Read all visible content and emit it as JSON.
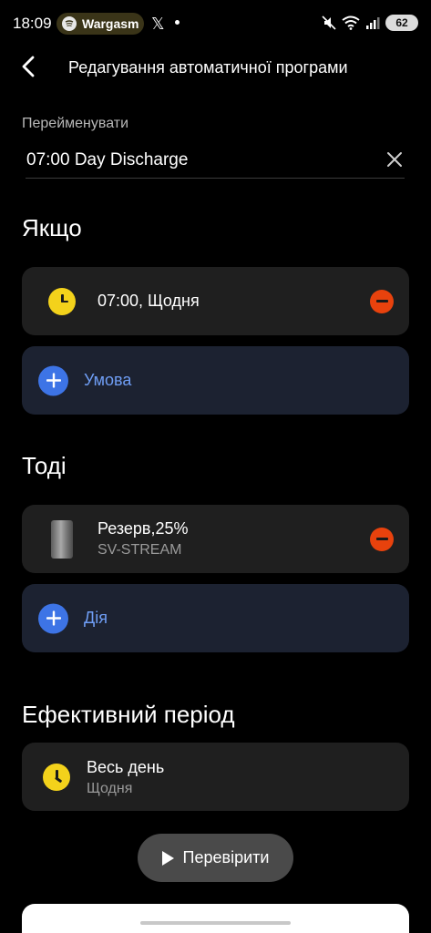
{
  "status_bar": {
    "time": "18:09",
    "notification_app": "Wargasm",
    "x_app": "𝕏",
    "battery": "62"
  },
  "header": {
    "title": "Редагування автоматичної програми"
  },
  "rename": {
    "label": "Перейменувати",
    "value": "07:00 Day Discharge"
  },
  "if_section": {
    "title": "Якщо",
    "conditions": [
      {
        "text": "07:00, Щодня",
        "icon": "clock-icon"
      }
    ],
    "add_label": "Умова"
  },
  "then_section": {
    "title": "Тоді",
    "actions": [
      {
        "title": "Резерв,25%",
        "device": "SV-STREAM",
        "icon": "device-icon"
      }
    ],
    "add_label": "Дія"
  },
  "period_section": {
    "title": "Ефективний період",
    "period": {
      "title": "Весь день",
      "subtitle": "Щодня",
      "icon": "clock-icon"
    }
  },
  "test_button": {
    "label": "Перевірити"
  },
  "colors": {
    "background": "#000000",
    "card": "#1f1f1f",
    "add_card": "#1c2231",
    "accent_blue": "#3d74e6",
    "remove_red": "#e8420d",
    "clock_yellow": "#f3d21b"
  }
}
